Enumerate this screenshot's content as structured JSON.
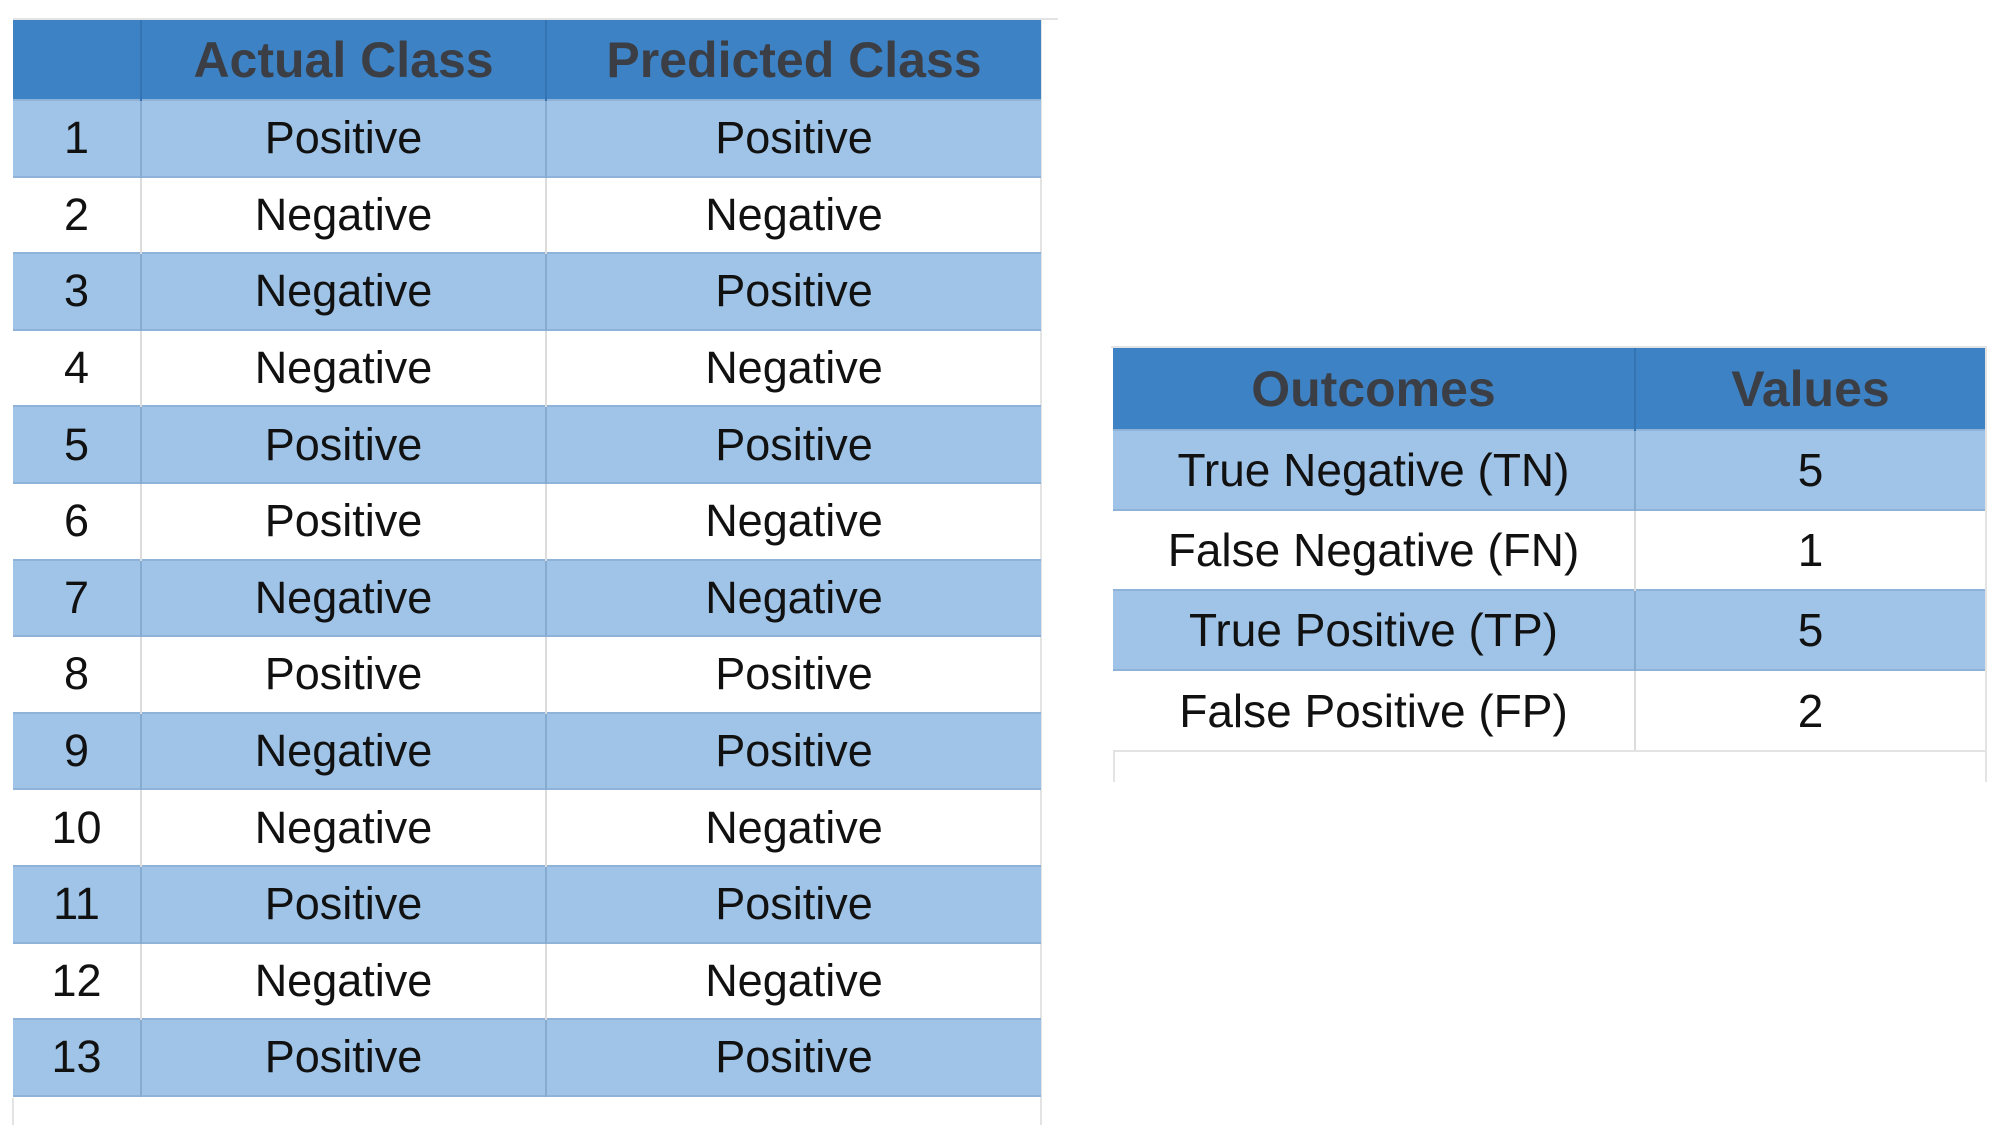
{
  "class_table": {
    "headers": [
      "",
      "Actual Class",
      "Predicted Class"
    ],
    "rows": [
      {
        "index": "1",
        "actual": "Positive",
        "predicted": "Positive"
      },
      {
        "index": "2",
        "actual": "Negative",
        "predicted": "Negative"
      },
      {
        "index": "3",
        "actual": "Negative",
        "predicted": "Positive"
      },
      {
        "index": "4",
        "actual": "Negative",
        "predicted": "Negative"
      },
      {
        "index": "5",
        "actual": "Positive",
        "predicted": "Positive"
      },
      {
        "index": "6",
        "actual": "Positive",
        "predicted": "Negative"
      },
      {
        "index": "7",
        "actual": "Negative",
        "predicted": "Negative"
      },
      {
        "index": "8",
        "actual": "Positive",
        "predicted": "Positive"
      },
      {
        "index": "9",
        "actual": "Negative",
        "predicted": "Positive"
      },
      {
        "index": "10",
        "actual": "Negative",
        "predicted": "Negative"
      },
      {
        "index": "11",
        "actual": "Positive",
        "predicted": "Positive"
      },
      {
        "index": "12",
        "actual": "Negative",
        "predicted": "Negative"
      },
      {
        "index": "13",
        "actual": "Positive",
        "predicted": "Positive"
      }
    ]
  },
  "outcome_table": {
    "headers": [
      "Outcomes",
      "Values"
    ],
    "rows": [
      {
        "outcome": "True Negative (TN)",
        "value": "5"
      },
      {
        "outcome": "False Negative (FN)",
        "value": "1"
      },
      {
        "outcome": "True Positive (TP)",
        "value": "5"
      },
      {
        "outcome": "False Positive (FP)",
        "value": "2"
      }
    ]
  },
  "colors": {
    "header_fill": "#3d82c5",
    "header_text": "#3b3f45",
    "band_fill": "#9fc4e7",
    "plain_fill": "#ffffff",
    "gridline": "#e3e3e3"
  }
}
